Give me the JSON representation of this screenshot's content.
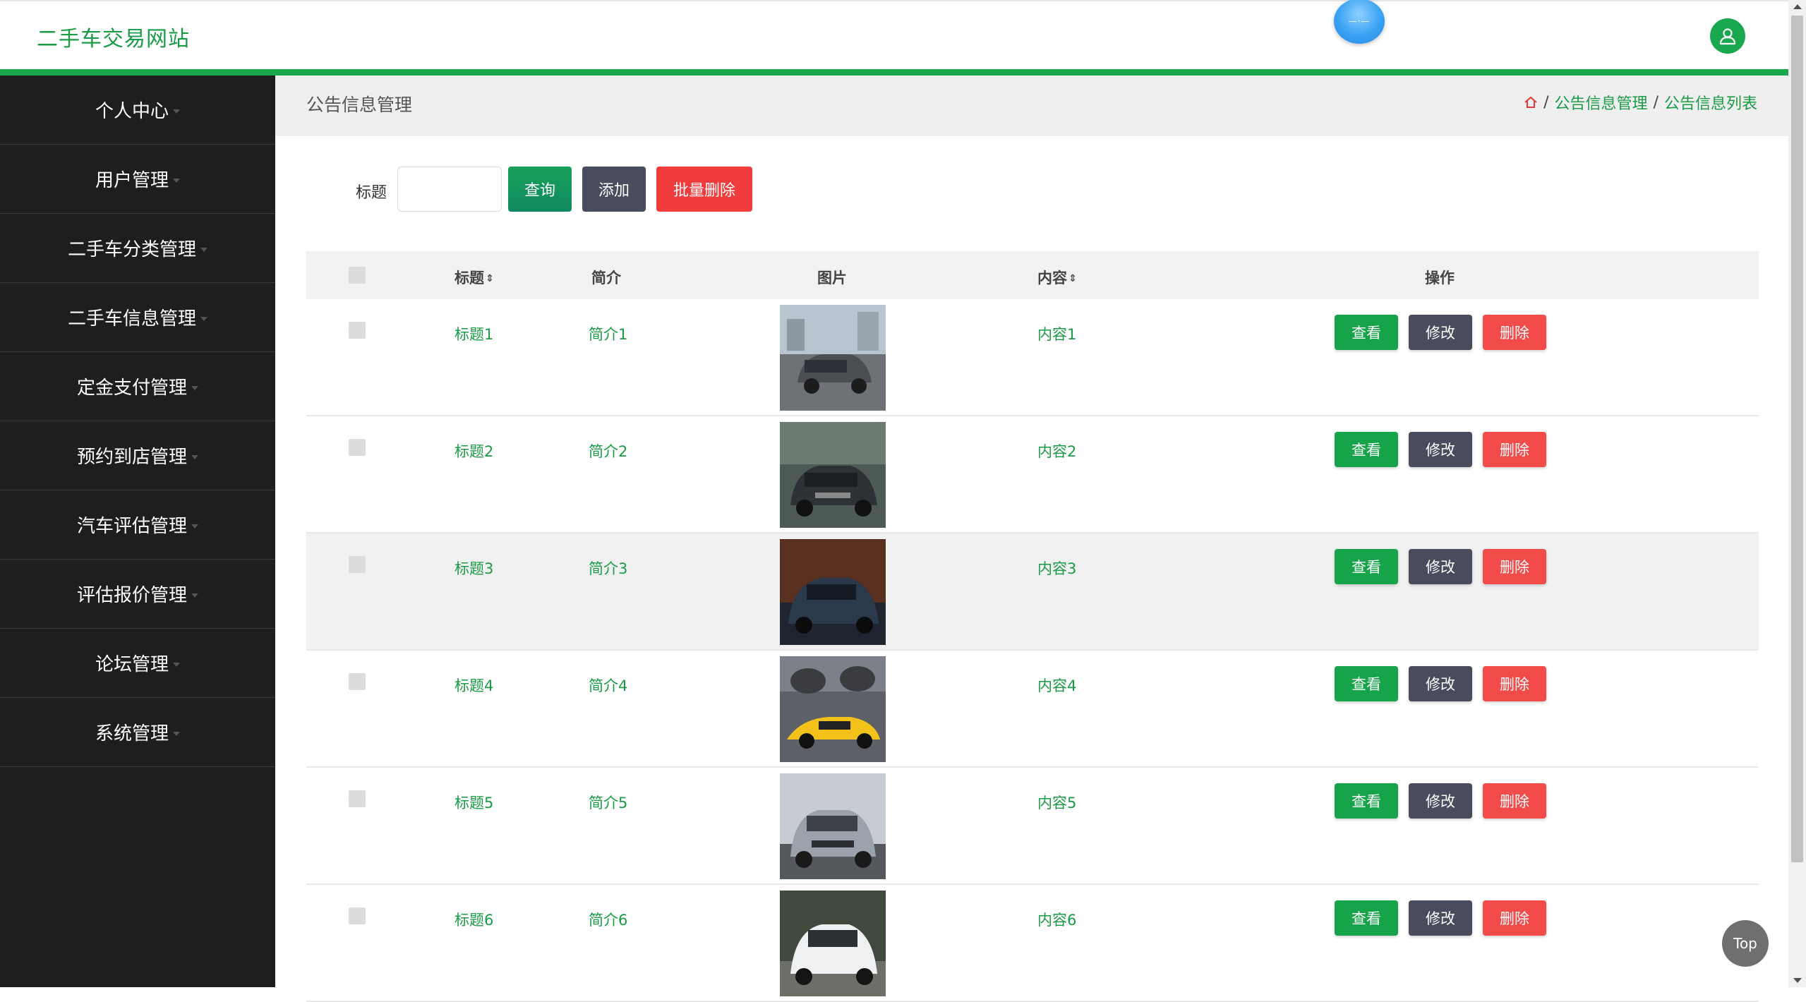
{
  "header": {
    "site_title": "二手车交易网站",
    "badge_text": "—·—",
    "avatar_icon": "user-icon"
  },
  "sidebar": {
    "items": [
      {
        "label": "个人中心"
      },
      {
        "label": "用户管理"
      },
      {
        "label": "二手车分类管理"
      },
      {
        "label": "二手车信息管理"
      },
      {
        "label": "定金支付管理"
      },
      {
        "label": "预约到店管理"
      },
      {
        "label": "汽车评估管理"
      },
      {
        "label": "评估报价管理"
      },
      {
        "label": "论坛管理"
      },
      {
        "label": "系统管理"
      }
    ]
  },
  "page": {
    "title": "公告信息管理",
    "breadcrumb": [
      "公告信息管理",
      "公告信息列表"
    ],
    "home_icon": "home-icon"
  },
  "search": {
    "label": "标题",
    "value": "",
    "query_label": "查询",
    "add_label": "添加",
    "batch_delete_label": "批量删除"
  },
  "table": {
    "columns": [
      "标题",
      "简介",
      "图片",
      "内容",
      "操作"
    ],
    "sortable": [
      "标题",
      "内容"
    ],
    "rows": [
      {
        "title": "标题1",
        "intro": "简介1",
        "content": "内容1"
      },
      {
        "title": "标题2",
        "intro": "简介2",
        "content": "内容2"
      },
      {
        "title": "标题3",
        "intro": "简介3",
        "content": "内容3"
      },
      {
        "title": "标题4",
        "intro": "简介4",
        "content": "内容4"
      },
      {
        "title": "标题5",
        "intro": "简介5",
        "content": "内容5"
      },
      {
        "title": "标题6",
        "intro": "简介6",
        "content": "内容6"
      }
    ],
    "actions": {
      "view": "查看",
      "edit": "修改",
      "delete": "删除"
    }
  },
  "top_button": "Top",
  "colors": {
    "brand_green": "#1aa84f",
    "sidebar_bg": "#1e1e1e",
    "danger": "#f34a4a",
    "neutral_btn": "#484c5c"
  }
}
